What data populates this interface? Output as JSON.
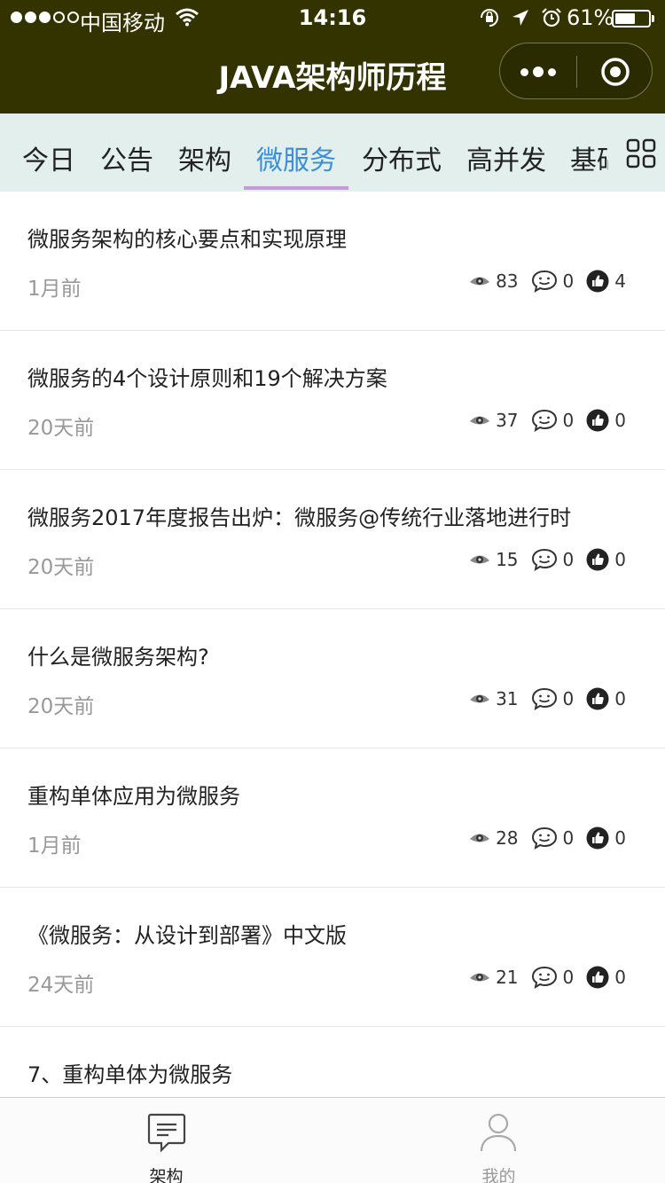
{
  "status_bar": {
    "carrier": "中国移动",
    "time": "14:16",
    "battery": "61%",
    "battery_level": 0.61
  },
  "title_bar": {
    "title": "JAVA架构师历程",
    "more_icon": "more-dots-icon",
    "close_icon": "close-target-icon"
  },
  "tabs": [
    {
      "label": "今日"
    },
    {
      "label": "公告"
    },
    {
      "label": "架构"
    },
    {
      "label": "微服务"
    },
    {
      "label": "分布式"
    },
    {
      "label": "高并发"
    },
    {
      "label": "基础"
    }
  ],
  "active_tab": "微服务",
  "articles": [
    {
      "title": "微服务架构的核心要点和实现原理",
      "time": "1月前",
      "views": "83",
      "comments": "0",
      "likes": "4"
    },
    {
      "title": "微服务的4个设计原则和19个解决方案",
      "time": "20天前",
      "views": "37",
      "comments": "0",
      "likes": "0"
    },
    {
      "title": "微服务2017年度报告出炉：微服务@传统行业落地进行时",
      "time": "20天前",
      "views": "15",
      "comments": "0",
      "likes": "0"
    },
    {
      "title": "什么是微服务架构?",
      "time": "20天前",
      "views": "31",
      "comments": "0",
      "likes": "0"
    },
    {
      "title": "重构单体应用为微服务",
      "time": "1月前",
      "views": "28",
      "comments": "0",
      "likes": "0"
    },
    {
      "title": "《微服务：从设计到部署》中文版",
      "time": "24天前",
      "views": "21",
      "comments": "0",
      "likes": "0"
    },
    {
      "title": "7、重构单体为微服务",
      "time": "",
      "views": "",
      "comments": "",
      "likes": ""
    }
  ],
  "bottom_nav": {
    "items": [
      {
        "label": "架构",
        "icon": "message-icon",
        "active": true
      },
      {
        "label": "我的",
        "icon": "user-icon",
        "active": false
      }
    ]
  },
  "colors": {
    "header_bg": "#333300",
    "tab_bg": "#e3efec",
    "active_tab_text": "#3b8fd8",
    "tab_underline": "#c59ad7"
  }
}
